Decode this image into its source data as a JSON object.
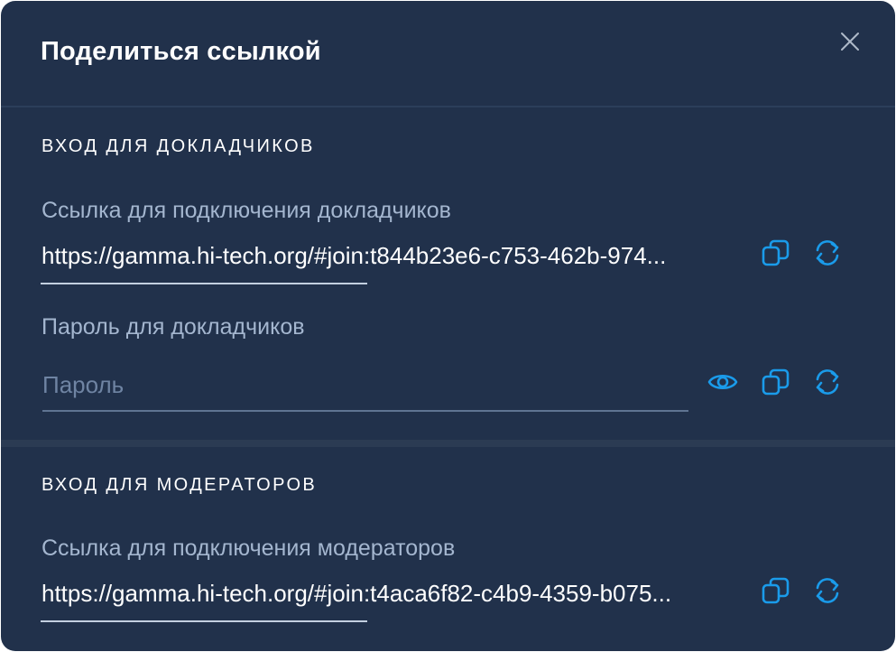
{
  "dialog": {
    "title": "Поделиться ссылкой",
    "close_icon": "close-icon"
  },
  "speakers": {
    "heading": "Вход для докладчиков",
    "link_label": "Ссылка для подключения докладчиков",
    "link_value": "https://gamma.hi-tech.org/#join:t844b23e6-c753-462b-974...",
    "password_label": "Пароль для докладчиков",
    "password_placeholder": "Пароль",
    "password_value": ""
  },
  "moderators": {
    "heading": "Вход для модераторов",
    "link_label": "Ссылка для подключения модераторов",
    "link_value": "https://gamma.hi-tech.org/#join:t4aca6f82-c4b9-4359-b075..."
  },
  "icons": {
    "copy": "copy-icon",
    "regenerate": "refresh-icon",
    "show_password": "eye-icon"
  },
  "colors": {
    "background": "#21314b",
    "accent": "#1a9bea",
    "label": "#a4b6cf",
    "text": "#ffffff"
  }
}
